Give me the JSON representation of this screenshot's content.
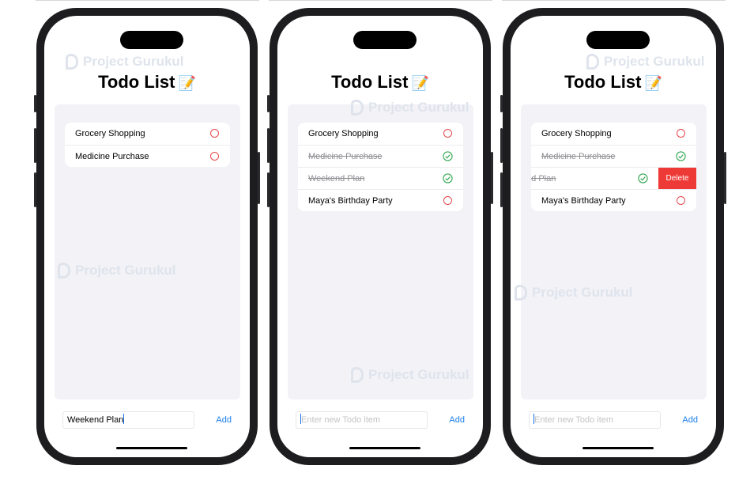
{
  "colors": {
    "accent": "#1a7ee6",
    "incomplete": "#e5484d",
    "complete": "#34a853",
    "delete": "#ee3a36",
    "panel": "#f2f2f7"
  },
  "watermark": "Project Gurukul",
  "screens": [
    {
      "title": "Todo List",
      "title_emoji": "📝",
      "todos": [
        {
          "label": "Grocery Shopping",
          "done": false
        },
        {
          "label": "Medicine Purchase",
          "done": false
        }
      ],
      "input_value": "Weekend Plan",
      "input_placeholder": "",
      "add_label": "Add"
    },
    {
      "title": "Todo List",
      "title_emoji": "📝",
      "todos": [
        {
          "label": "Grocery Shopping",
          "done": false
        },
        {
          "label": "Medicine Purchase",
          "done": true
        },
        {
          "label": "Weekend Plan",
          "done": true
        },
        {
          "label": "Maya's Birthday Party",
          "done": false
        }
      ],
      "input_value": "",
      "input_placeholder": "Enter new Todo item",
      "add_label": "Add"
    },
    {
      "title": "Todo List",
      "title_emoji": "📝",
      "todos": [
        {
          "label": "Grocery Shopping",
          "done": false
        },
        {
          "label": "Medicine Purchase",
          "done": true
        },
        {
          "label": "Weekend Plan",
          "done": true,
          "swiped": true
        },
        {
          "label": "Maya's Birthday Party",
          "done": false
        }
      ],
      "delete_label": "Delete",
      "input_value": "",
      "input_placeholder": "Enter new Todo item",
      "add_label": "Add"
    }
  ]
}
